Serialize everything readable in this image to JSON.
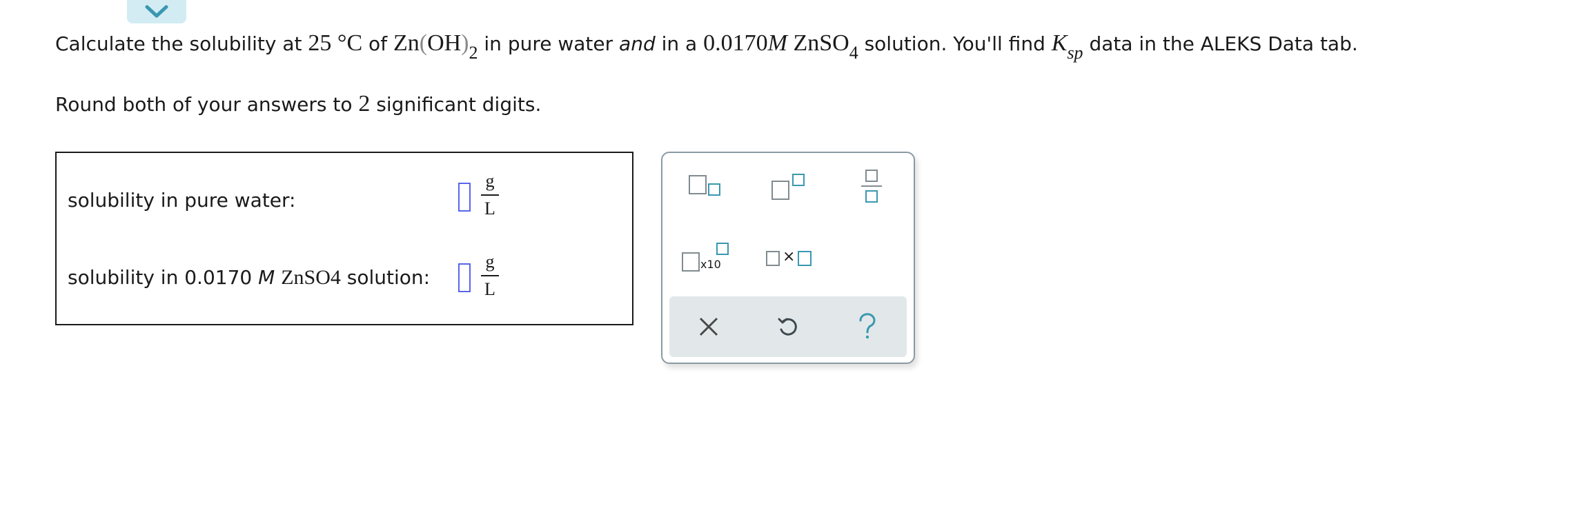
{
  "question": {
    "p1": "Calculate the solubility at ",
    "temp": "25 °C",
    "p2": " of ",
    "formula_base": "Zn",
    "paren_open": "(",
    "formula_group": "OH",
    "paren_close": ")",
    "formula_sub": "2",
    "p3": " in pure water ",
    "and": "and",
    "p4": " in a ",
    "conc": "0.0170",
    "molar": "M",
    "salt_base": "ZnSO",
    "salt_sub": "4",
    "p5": " solution. You'll find ",
    "ksp_k": "K",
    "ksp_sub": "sp",
    "p6": " data in the ALEKS Data tab."
  },
  "round": {
    "p1": "Round both of your answers to ",
    "digits": "2",
    "p2": " significant digits."
  },
  "answers": {
    "row1": {
      "label": "solubility in pure water:",
      "unit_num": "g",
      "unit_den": "L",
      "value": ""
    },
    "row2": {
      "label_p1": "solubility in 0.0170 ",
      "label_M": "M",
      "label_salt": "ZnSO",
      "label_salt_sub": "4",
      "label_p2": " solution:",
      "unit_num": "g",
      "unit_den": "L",
      "value": ""
    }
  },
  "toolbar": {
    "x10_label": "x10",
    "times_symbol": "×",
    "icons": [
      "subscript-icon",
      "superscript-icon",
      "fraction-icon",
      "scientific-notation-icon",
      "multiply-icon",
      "clear-icon",
      "undo-icon",
      "help-icon"
    ]
  },
  "colors": {
    "accent_blue": "#3a97b0",
    "input_border": "#5866e8",
    "tab_bg": "#d3ecf3",
    "panel_bottom_bg": "#e2e8ea"
  }
}
